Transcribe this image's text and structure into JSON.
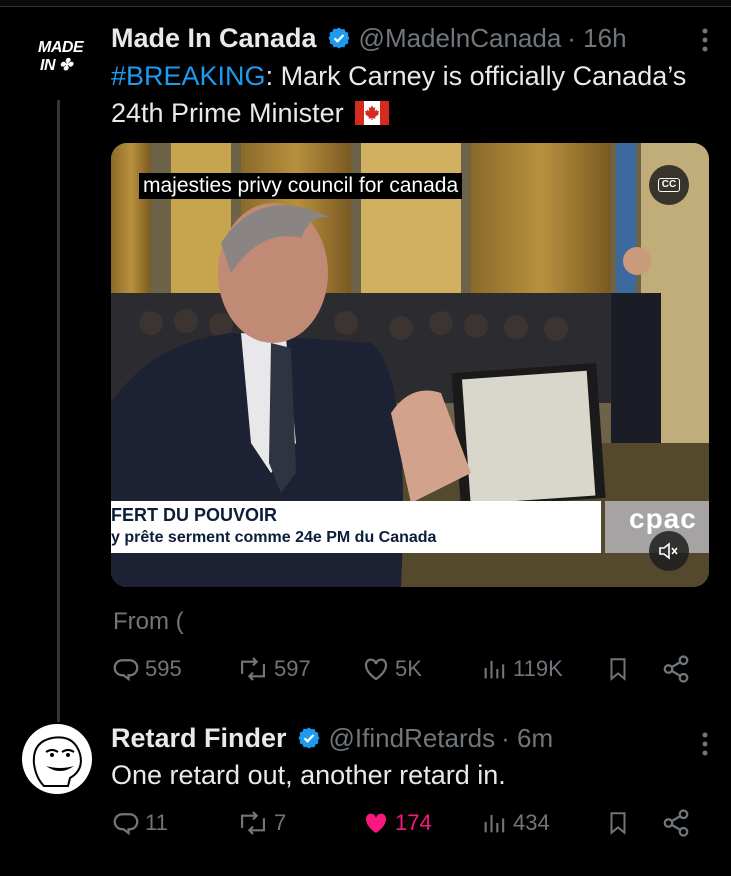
{
  "tweet1": {
    "avatar_line1": "MADE",
    "avatar_line2": "IN ✤",
    "name": "Made In Canada",
    "handle": "@MadelnCanada",
    "time": "· 16h",
    "hashtag": "#BREAKING",
    "text": ": Mark Carney is officially Canada’s 24th Prime Minister",
    "from": "From (",
    "replies": "595",
    "reposts": "597",
    "likes": "5K",
    "views": "119K"
  },
  "video": {
    "caption": "majesties privy council for canada",
    "cc_label": "CC",
    "banner_line1": "FERT DU POUVOIR",
    "banner_line2": "y prête serment comme 24e PM du Canada",
    "network": "cpac"
  },
  "tweet2": {
    "name": "Retard Finder",
    "handle": "@IfindRetards",
    "time": "· 6m",
    "text": "One retard out, another retard in.",
    "replies": "11",
    "reposts": "7",
    "likes": "174",
    "views": "434"
  },
  "colors": {
    "accent": "#1d9bf0",
    "muted": "#71767b",
    "like": "#f91880"
  },
  "icons": [
    "verified-badge-icon",
    "canada-flag-icon",
    "cc-icon",
    "mute-icon",
    "reply-icon",
    "repost-icon",
    "like-icon",
    "views-icon",
    "bookmark-icon",
    "share-icon",
    "more-icon"
  ]
}
